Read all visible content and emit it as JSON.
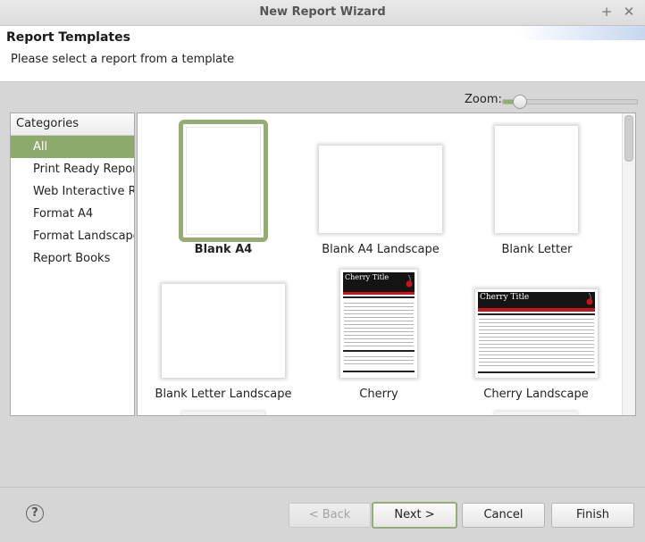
{
  "window": {
    "title": "New Report Wizard"
  },
  "header": {
    "title": "Report Templates",
    "description": "Please select a report from a template"
  },
  "zoom": {
    "label": "Zoom:",
    "level": 0.12
  },
  "categories": {
    "header": "Categories",
    "items": [
      {
        "label": "All",
        "selected": true
      },
      {
        "label": "Print Ready Reports",
        "selected": false
      },
      {
        "label": "Web Interactive Rep",
        "selected": false
      },
      {
        "label": "Format A4",
        "selected": false
      },
      {
        "label": "Format Landscape",
        "selected": false
      },
      {
        "label": "Report Books",
        "selected": false
      }
    ]
  },
  "templates": [
    {
      "label": "Blank A4",
      "selected": true
    },
    {
      "label": "Blank A4 Landscape",
      "selected": false
    },
    {
      "label": "Blank Letter",
      "selected": false
    },
    {
      "label": "Blank Letter Landscape",
      "selected": false
    },
    {
      "label": "Cherry",
      "selected": false,
      "preview_title": "Cherry Title"
    },
    {
      "label": "Cherry Landscape",
      "selected": false,
      "preview_title": "Cherry Title"
    }
  ],
  "buttons": {
    "help": "?",
    "back": "< Back",
    "next": "Next >",
    "cancel": "Cancel",
    "finish": "Finish"
  },
  "colors": {
    "accent": "#8ea96c",
    "cherry_red": "#c8151b",
    "cherry_band": "#141414"
  }
}
